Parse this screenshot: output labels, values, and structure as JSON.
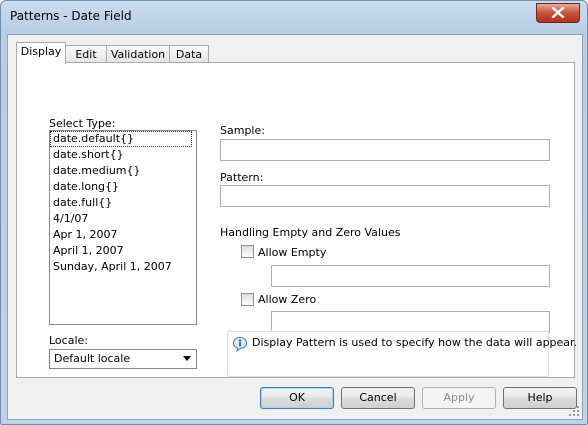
{
  "window": {
    "title": "Patterns - Date Field"
  },
  "tabs": [
    {
      "label": "Display",
      "active": true
    },
    {
      "label": "Edit",
      "active": false
    },
    {
      "label": "Validation",
      "active": false
    },
    {
      "label": "Data",
      "active": false
    }
  ],
  "select_type": {
    "label": "Select Type:",
    "items": [
      "date.default{}",
      "date.short{}",
      "date.medium{}",
      "date.long{}",
      "date.full{}",
      "4/1/07",
      "Apr 1, 2007",
      "April 1, 2007",
      "Sunday, April 1, 2007"
    ],
    "selected_index": 0
  },
  "locale": {
    "label": "Locale:",
    "value": "Default locale"
  },
  "sample": {
    "label": "Sample:",
    "value": ""
  },
  "pattern": {
    "label": "Pattern:",
    "value": ""
  },
  "empty_zero": {
    "heading": "Handling Empty and Zero Values",
    "allow_empty_label": "Allow Empty",
    "allow_empty_checked": false,
    "allow_empty_value": "",
    "allow_zero_label": "Allow Zero",
    "allow_zero_checked": false,
    "allow_zero_value": ""
  },
  "info": {
    "text": "Display Pattern is used to specify how the data will appear.",
    "icon": "info-speech-icon"
  },
  "buttons": {
    "ok": "OK",
    "cancel": "Cancel",
    "apply": "Apply",
    "help": "Help"
  },
  "colors": {
    "title_bar": "#c9dbee",
    "close_button": "#c75037",
    "default_button_border": "#3c7fb1"
  }
}
